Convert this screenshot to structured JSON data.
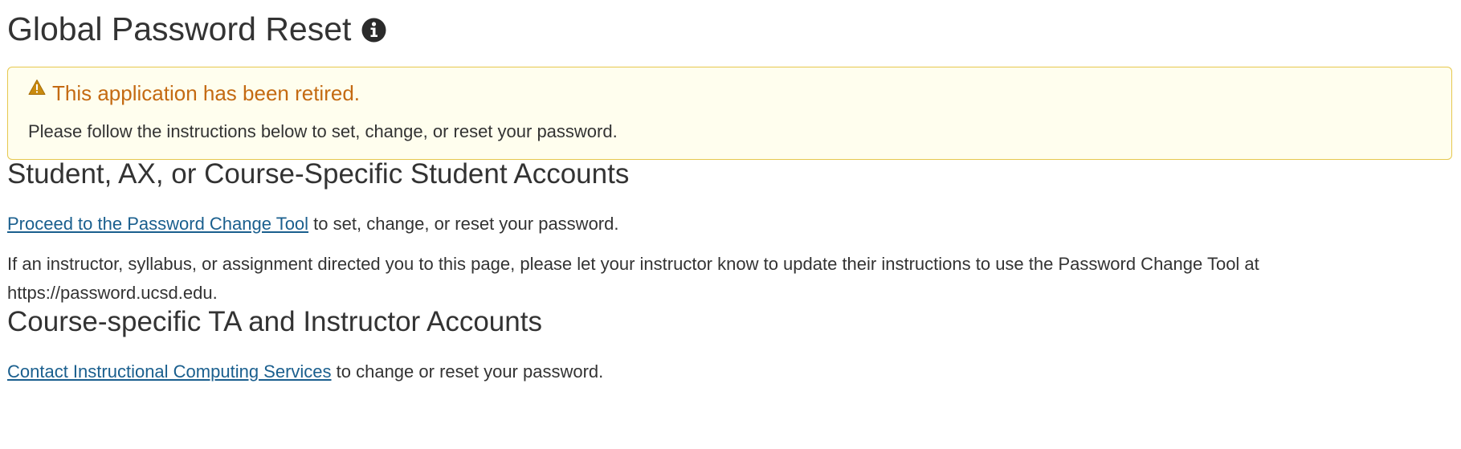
{
  "header": {
    "title": "Global Password Reset",
    "info_icon": "info-circle-icon"
  },
  "alert": {
    "icon": "warning-triangle-icon",
    "title": "This application has been retired.",
    "message": "Please follow the instructions below to set, change, or reset your password.",
    "colors": {
      "border": "#e6c84f",
      "background": "#fffeee",
      "title": "#c46a12"
    }
  },
  "student_section": {
    "heading": "Student, AX, or Course-Specific Student Accounts",
    "link_text": "Proceed to the Password Change Tool",
    "link_suffix": " to set, change, or reset your password.",
    "note": "If an instructor, syllabus, or assignment directed you to this page, please let your instructor know to update their instructions to use the Password Change Tool at https://password.ucsd.edu."
  },
  "ta_section": {
    "heading": "Course-specific TA and Instructor Accounts",
    "link_text": "Contact Instructional Computing Services",
    "link_suffix": " to change or reset your password."
  },
  "colors": {
    "link": "#1a5f8e",
    "text": "#333333"
  }
}
